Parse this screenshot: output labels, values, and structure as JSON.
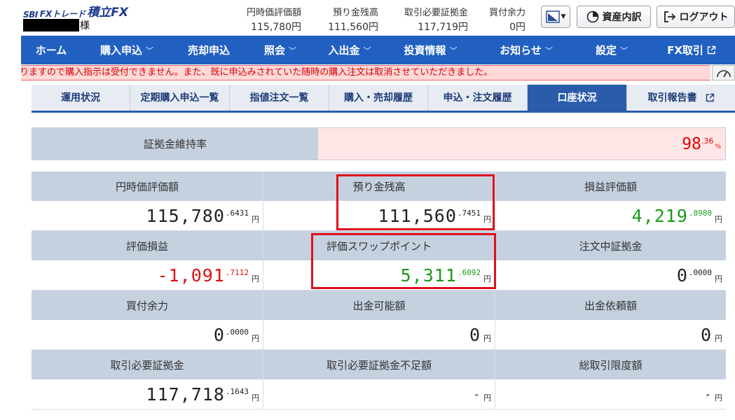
{
  "header": {
    "logo_sbi": "SBI",
    "logo_fx": "FXトレード",
    "logo_product": "積立FX",
    "user_suffix": "様",
    "summary": [
      {
        "label": "円時価評価額",
        "value": "115,780円"
      },
      {
        "label": "預り金残高",
        "value": "111,560円"
      },
      {
        "label": "取引必要証拠金",
        "value": "117,719円"
      },
      {
        "label": "買付余力",
        "value": "0円"
      }
    ],
    "assets_button": "資産内訳",
    "logout_button": "ログアウト"
  },
  "nav": [
    {
      "label": "ホーム",
      "dropdown": false
    },
    {
      "label": "購入申込",
      "dropdown": true
    },
    {
      "label": "売却申込",
      "dropdown": false
    },
    {
      "label": "照会",
      "dropdown": true
    },
    {
      "label": "入出金",
      "dropdown": true
    },
    {
      "label": "投資情報",
      "dropdown": true
    },
    {
      "label": "お知らせ",
      "dropdown": true
    },
    {
      "label": "設定",
      "dropdown": true
    },
    {
      "label": "FX取引",
      "dropdown": false
    }
  ],
  "alert": "りますので購入指示は受付できません。また、既に申込みされていた随時の購入注文は取消させていただきました。",
  "subtabs": [
    "運用状況",
    "定期購入申込一覧",
    "指値注文一覧",
    "購入・売却履歴",
    "申込・注文履歴",
    "口座状況",
    "取引報告書"
  ],
  "active_subtab": "口座状況",
  "margin_ratio": {
    "label": "証拠金維持率",
    "int": "98",
    "dec": ".36",
    "unit": "%"
  },
  "account": [
    {
      "label": "円時価評価額",
      "int": "115,780",
      "dec": ".6431",
      "unit": "円",
      "color": "#222222"
    },
    {
      "label": "預り金残高",
      "int": "111,560",
      "dec": ".7451",
      "unit": "円",
      "color": "#222222"
    },
    {
      "label": "損益評価額",
      "int": "4,219",
      "dec": ".8980",
      "unit": "円",
      "color": "#1a9a1a"
    },
    {
      "label": "評価損益",
      "int": "-1,091",
      "dec": ".7112",
      "unit": "円",
      "color": "#e01010"
    },
    {
      "label": "評価スワップポイント",
      "int": "5,311",
      "dec": ".6092",
      "unit": "円",
      "color": "#1a9a1a"
    },
    {
      "label": "注文中証拠金",
      "int": "0",
      "dec": ".0000",
      "unit": "円",
      "color": "#222222"
    },
    {
      "label": "買付余力",
      "int": "0",
      "dec": ".0000",
      "unit": "円",
      "color": "#222222"
    },
    {
      "label": "出金可能額",
      "int": "0",
      "dec": "",
      "unit": "円",
      "color": "#222222"
    },
    {
      "label": "出金依頼額",
      "int": "0",
      "dec": "",
      "unit": "円",
      "color": "#222222"
    },
    {
      "label": "取引必要証拠金",
      "int": "117,718",
      "dec": ".1643",
      "unit": "円",
      "color": "#222222"
    },
    {
      "label": "取引必要証拠金不足額",
      "int": "-",
      "dec": "",
      "unit": "円",
      "color": "#222222"
    },
    {
      "label": "総取引限度額",
      "int": "-",
      "dec": "",
      "unit": "円",
      "color": "#222222"
    }
  ],
  "colors": {
    "nav": "#2160c1",
    "highlight_box": "#e0101e"
  }
}
